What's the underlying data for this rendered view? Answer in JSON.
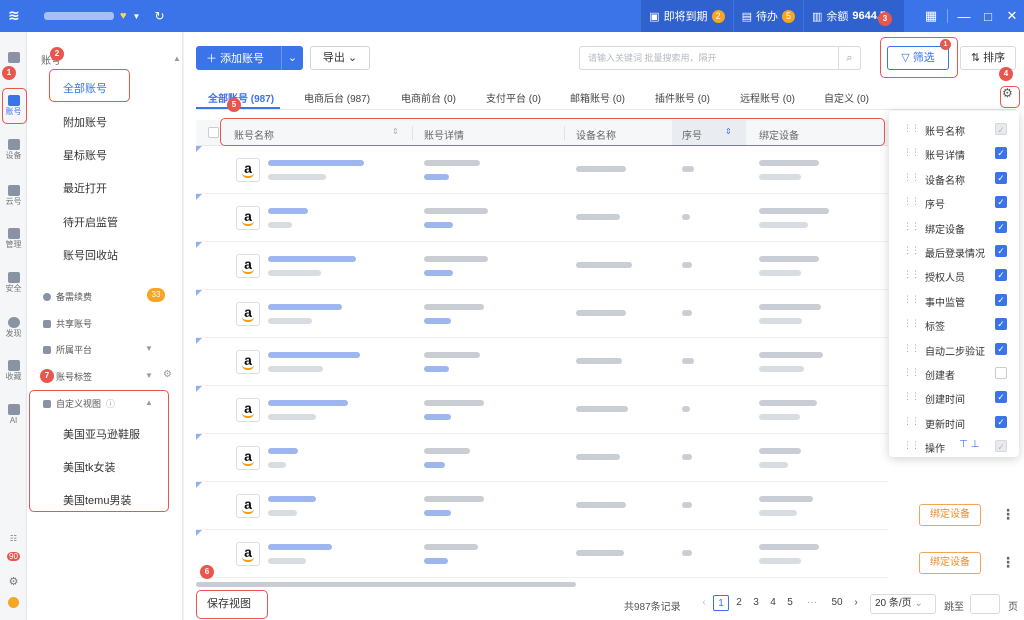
{
  "titlebar": {
    "expiring_label": "即将到期",
    "expiring_count": "2",
    "todo_label": "待办",
    "todo_count": "5",
    "balance_label": "余额",
    "balance_value": "9644.5"
  },
  "leftbar": {
    "items": [
      {
        "label": "",
        "icon": "home-icon"
      },
      {
        "label": "账号",
        "icon": "account-icon"
      },
      {
        "label": "设备",
        "icon": "device-icon"
      },
      {
        "label": "云号",
        "icon": "cloud-icon"
      },
      {
        "label": "管理",
        "icon": "manage-icon"
      },
      {
        "label": "安全",
        "icon": "security-icon"
      },
      {
        "label": "发现",
        "icon": "discover-icon"
      },
      {
        "label": "收藏",
        "icon": "star-icon"
      },
      {
        "label": "AI",
        "icon": "ai-icon"
      }
    ],
    "bottom_badge": "90"
  },
  "sidebar": {
    "section_title": "账号",
    "items": [
      "全部账号",
      "附加账号",
      "星标账号",
      "最近打开",
      "待开启监管",
      "账号回收站"
    ],
    "sub_items": [
      "备需续费",
      "共享账号",
      "所属平台",
      "账号标签"
    ],
    "renew_badge": "33",
    "custom_view_title": "自定义视图",
    "custom_views": [
      "美国亚马逊鞋服",
      "美国tk女装",
      "美国temu男装"
    ]
  },
  "toolbar": {
    "add_label": "添加账号",
    "export_label": "导出",
    "search_placeholder": "请输入关键词 批量搜索用，隔开",
    "filter_label": "筛选",
    "filter_badge": "1",
    "sort_label": "排序"
  },
  "tabs": [
    "全部账号 (987)",
    "电商后台 (987)",
    "电商前台 (0)",
    "支付平台 (0)",
    "邮箱账号 (0)",
    "插件账号 (0)",
    "远程账号 (0)",
    "自定义 (0)"
  ],
  "table": {
    "columns": [
      "账号名称",
      "账号详情",
      "设备名称",
      "序号",
      "绑定设备"
    ],
    "platform_logo": "a",
    "bind_label": "绑定设备"
  },
  "column_settings": [
    {
      "label": "账号名称",
      "state": "disabled"
    },
    {
      "label": "账号详情",
      "state": "on"
    },
    {
      "label": "设备名称",
      "state": "on"
    },
    {
      "label": "序号",
      "state": "on"
    },
    {
      "label": "绑定设备",
      "state": "on"
    },
    {
      "label": "最后登录情况",
      "state": "on"
    },
    {
      "label": "授权人员",
      "state": "on"
    },
    {
      "label": "事中监管",
      "state": "on"
    },
    {
      "label": "标签",
      "state": "on"
    },
    {
      "label": "自动二步验证",
      "state": "on"
    },
    {
      "label": "创建者",
      "state": "off"
    },
    {
      "label": "创建时间",
      "state": "on"
    },
    {
      "label": "更新时间",
      "state": "on"
    },
    {
      "label": "操作",
      "state": "disabled"
    }
  ],
  "footer": {
    "save_view_label": "保存视图",
    "total_text": "共987条记录",
    "pages": [
      "1",
      "2",
      "3",
      "4",
      "5",
      "···",
      "50"
    ],
    "page_size": "20 条/页",
    "goto_label": "跳至",
    "page_unit": "页"
  },
  "annotations": [
    "1",
    "2",
    "3",
    "4",
    "5",
    "6",
    "7"
  ],
  "colors": {
    "primary": "#3b73e8",
    "annotation": "#e8574d",
    "bind_button": "#f08a2c"
  }
}
